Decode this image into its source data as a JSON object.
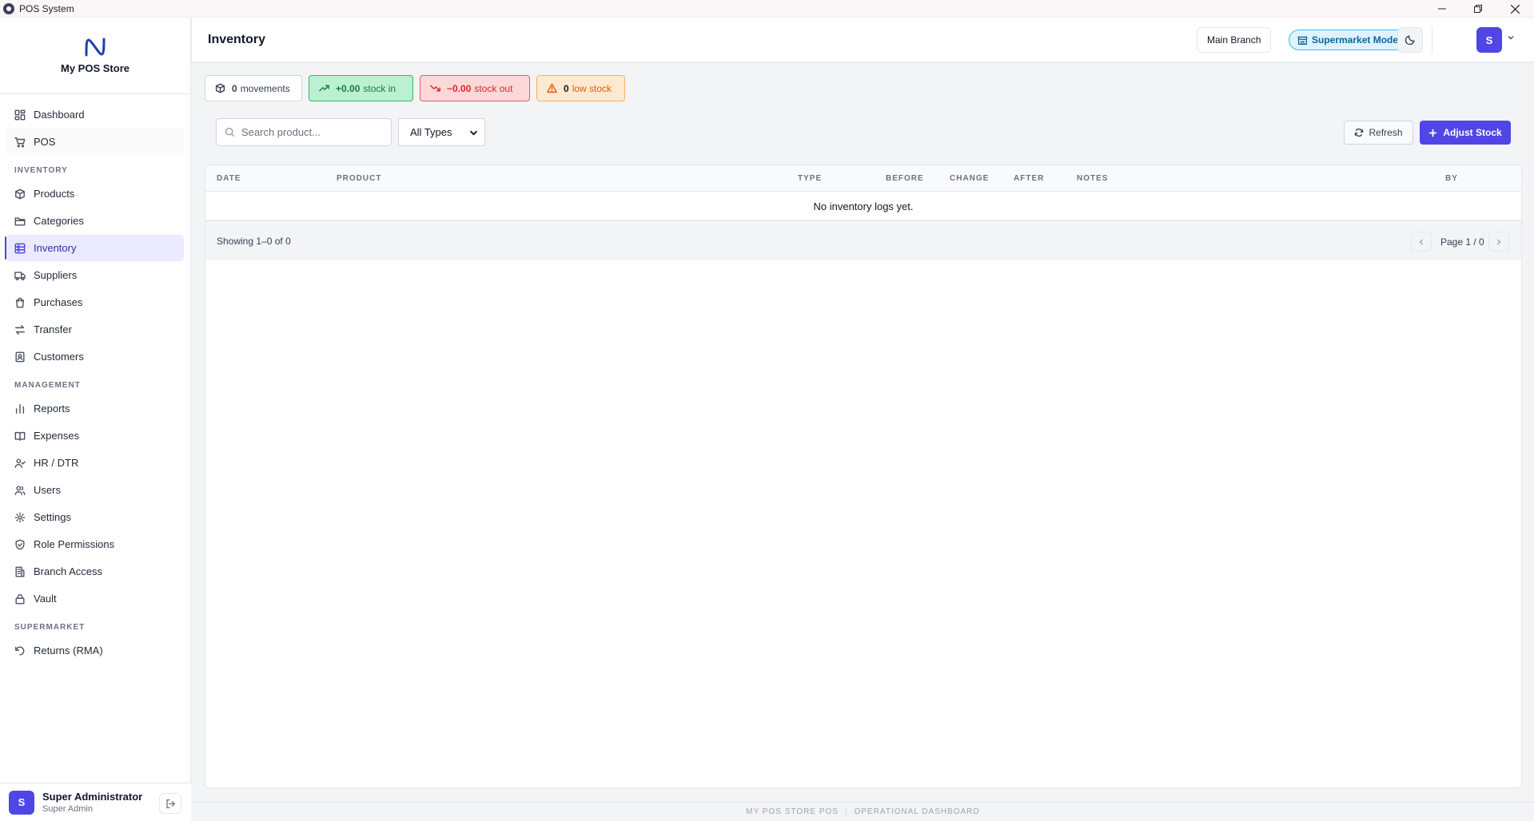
{
  "window": {
    "title": "POS System"
  },
  "brand": {
    "name": "My POS Store"
  },
  "sidebar": {
    "top_items": [
      {
        "label": "Dashboard",
        "icon": "dashboard-icon"
      },
      {
        "label": "POS",
        "icon": "cart-icon"
      }
    ],
    "sections": [
      {
        "label": "INVENTORY",
        "items": [
          {
            "label": "Products",
            "icon": "box-icon"
          },
          {
            "label": "Categories",
            "icon": "folder-icon"
          },
          {
            "label": "Inventory",
            "icon": "database-icon",
            "active": true
          },
          {
            "label": "Suppliers",
            "icon": "truck-icon"
          },
          {
            "label": "Purchases",
            "icon": "shopping-bag-icon"
          },
          {
            "label": "Transfer",
            "icon": "transfer-icon"
          },
          {
            "label": "Customers",
            "icon": "contacts-icon"
          }
        ]
      },
      {
        "label": "MANAGEMENT",
        "items": [
          {
            "label": "Reports",
            "icon": "bar-chart-icon"
          },
          {
            "label": "Expenses",
            "icon": "book-icon"
          },
          {
            "label": "HR / DTR",
            "icon": "user-check-icon"
          },
          {
            "label": "Users",
            "icon": "users-icon"
          },
          {
            "label": "Settings",
            "icon": "gear-icon"
          },
          {
            "label": "Role Permissions",
            "icon": "shield-check-icon"
          },
          {
            "label": "Branch Access",
            "icon": "building-icon"
          },
          {
            "label": "Vault",
            "icon": "lock-icon"
          }
        ]
      },
      {
        "label": "SUPERMARKET",
        "items": [
          {
            "label": "Returns (RMA)",
            "icon": "rotate-ccw-icon"
          }
        ]
      }
    ]
  },
  "user": {
    "initial": "S",
    "name": "Super Administrator",
    "role": "Super Admin"
  },
  "header": {
    "title": "Inventory",
    "branch_label": "Main Branch",
    "mode_label": "Supermarket Mode",
    "avatar_initial": "S"
  },
  "stats": {
    "movements_count": "0",
    "movements_label": "movements",
    "stock_in_value": "+0.00",
    "stock_in_label": "stock in",
    "stock_out_value": "−0.00",
    "stock_out_label": "stock out",
    "low_stock_count": "0",
    "low_stock_label": "low stock"
  },
  "toolbar": {
    "search_placeholder": "Search product...",
    "type_filter_value": "All Types",
    "refresh_label": "Refresh",
    "adjust_label": "Adjust Stock"
  },
  "table": {
    "columns": [
      "DATE",
      "PRODUCT",
      "TYPE",
      "BEFORE",
      "CHANGE",
      "AFTER",
      "NOTES",
      "BY"
    ],
    "empty_message": "No inventory logs yet.",
    "showing_text": "Showing 1–0 of 0",
    "page_text": "Page 1 / 0"
  },
  "footer": {
    "left": "MY POS STORE POS",
    "right": "OPERATIONAL DASHBOARD"
  },
  "colors": {
    "accent": "#4f46e5",
    "mode_badge": "#0369a1",
    "stock_in": "#15803d",
    "stock_out": "#dc2626",
    "low_stock": "#ea580c"
  }
}
